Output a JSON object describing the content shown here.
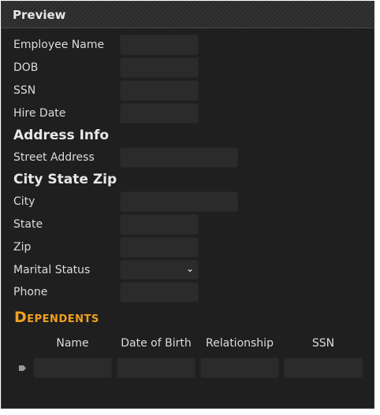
{
  "window": {
    "title": "Preview"
  },
  "form": {
    "employee_name_label": "Employee Name",
    "dob_label": "DOB",
    "ssn_label": "SSN",
    "hire_date_label": "Hire Date",
    "address_section": "Address Info",
    "street_label": "Street Address",
    "city_section": "City State Zip",
    "city_label": "City",
    "state_label": "State",
    "zip_label": "Zip",
    "marital_label": "Marital Status",
    "marital_value": "",
    "phone_label": "Phone"
  },
  "dependents": {
    "title": "Dependents",
    "columns": [
      "Name",
      "Date of Birth",
      "Relationship",
      "SSN"
    ]
  },
  "colors": {
    "background": "#1f1f1f",
    "field": "#2b2b2b",
    "accent": "#f0a020",
    "text": "#dcdcdc"
  }
}
